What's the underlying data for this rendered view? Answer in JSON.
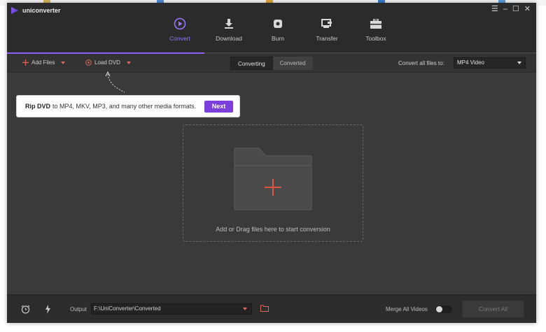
{
  "app": {
    "title": "uniconverter"
  },
  "window_controls": {
    "menu": "☰",
    "minimize": "–",
    "maximize": "☐",
    "close": "✕"
  },
  "nav": {
    "tabs": [
      {
        "label": "Convert",
        "icon": "convert-icon",
        "active": true
      },
      {
        "label": "Download",
        "icon": "download-icon",
        "active": false
      },
      {
        "label": "Burn",
        "icon": "burn-icon",
        "active": false
      },
      {
        "label": "Transfer",
        "icon": "transfer-icon",
        "active": false
      },
      {
        "label": "Toolbox",
        "icon": "toolbox-icon",
        "active": false
      }
    ]
  },
  "toolbar": {
    "add_files": "Add Files",
    "load_dvd": "Load DVD",
    "seg_converting": "Converting",
    "seg_converted": "Converted",
    "convert_all_to_label": "Convert all files to:",
    "format_value": "MP4 Video"
  },
  "tooltip": {
    "bold": "Rip DVD",
    "text": "to MP4, MKV, MP3, and many other media formats.",
    "next": "Next"
  },
  "dropzone": {
    "text": "Add or Drag files here to start conversion"
  },
  "bottom": {
    "output_label": "Output",
    "output_path": "F:\\UniConverter\\Converted",
    "merge_label": "Merge All Videos",
    "merge_on": false,
    "convert_all": "Convert All"
  },
  "colors": {
    "accent": "#8b5cf6",
    "next_button": "#7d3fdc",
    "add_icon": "#e06a5a",
    "background": "#3a3a3a"
  }
}
